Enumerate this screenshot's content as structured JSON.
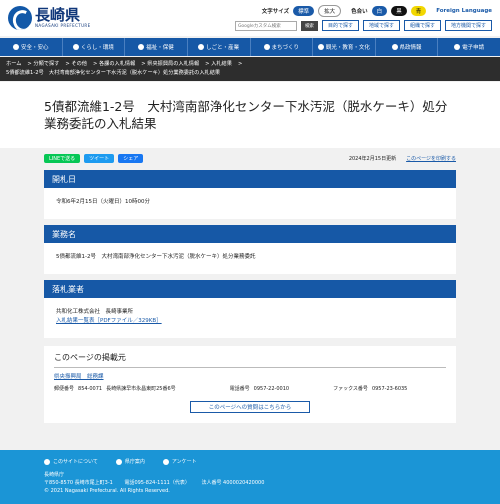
{
  "header": {
    "logo_jp": "長崎県",
    "logo_en": "NAGASAKI PREFECTURE",
    "text_size_label": "文字サイズ",
    "text_size_standard": "標準",
    "text_size_large": "拡大",
    "color_label": "色合い",
    "color_white": "白",
    "color_black": "黒",
    "color_blue": "青",
    "foreign_language": "Foreign Language",
    "search_placeholder": "Googleカスタム検索",
    "search_button": "検索",
    "btn_purpose": "目的で探す",
    "btn_region": "地域で探す",
    "btn_org": "組織で探す",
    "btn_local": "地方機関で探す"
  },
  "nav": [
    {
      "label": "安全・安心",
      "icon": "shield-icon"
    },
    {
      "label": "くらし・環境",
      "icon": "leaf-icon"
    },
    {
      "label": "福祉・保健",
      "icon": "heart-icon"
    },
    {
      "label": "しごと・産業",
      "icon": "briefcase-icon"
    },
    {
      "label": "まちづくり",
      "icon": "building-icon"
    },
    {
      "label": "観光・教育・文化",
      "icon": "star-icon"
    },
    {
      "label": "県政情報",
      "icon": "document-icon"
    },
    {
      "label": "電子申請",
      "icon": "computer-icon"
    }
  ],
  "breadcrumb": {
    "items": [
      "ホーム",
      "分類で探す",
      "その他",
      "各課の入札情報",
      "県央振興局の入札情報",
      "入札結果"
    ],
    "current": "5債都流維1-2号　大村湾南部浄化センター下水汚泥（脱水ケーキ）処分業務委託の入札結果"
  },
  "page": {
    "title": "5債都流維1-2号　大村湾南部浄化センター下水汚泥（脱水ケーキ）処分業務委託の入札結果",
    "share_line": "LINEで送る",
    "share_tweet": "ツイート",
    "share_fb": "シェア",
    "updated": "2024年2月15日更新",
    "mobile_link": "このページを印刷する"
  },
  "sections": {
    "bid_date_head": "開札日",
    "bid_date": "令和6年2月15日（火曜日）10時00分",
    "work_name_head": "業務名",
    "work_name": "5債都流維1-2号　大村湾南部浄化センター下水汚泥（脱水ケーキ）処分業務委託",
    "winner_head": "落札業者",
    "winner": "共和化工株式会社　長崎事業所",
    "results_link": "入札結果一覧表［PDFファイル／329KB］"
  },
  "contact": {
    "heading": "このページの掲載元",
    "dept": "県央振興局　総務課",
    "postal_label": "郵便番号",
    "postal": "854-0071",
    "address": "長崎県諫早市永昌東町25番6号",
    "tel_label": "電話番号",
    "tel": "0957-22-0010",
    "fax_label": "ファックス番号",
    "fax": "0957-23-6035",
    "ask_button": "このページへの質問はこちらから"
  },
  "footer": {
    "link1": "このサイトについて",
    "link2": "県庁案内",
    "link3": "アンケート",
    "org": "長崎県庁",
    "postal": "〒850-8570 長崎市尾上町3-1",
    "tel": "電話095-824-1111（代表）",
    "corp_no": "法人番号 4000020420000",
    "copyright": "© 2021 Nagasaki Prefectural. All Rights Reserved."
  }
}
